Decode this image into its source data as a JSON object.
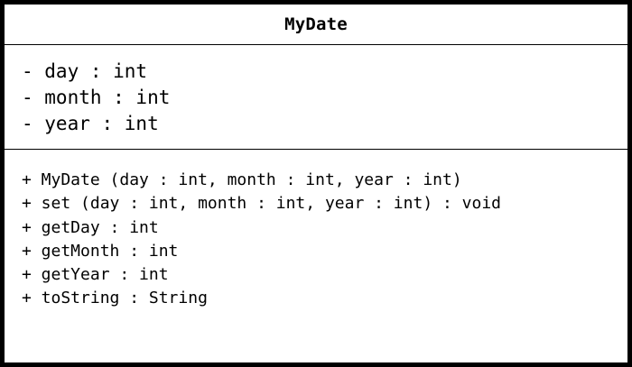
{
  "class": {
    "name": "MyDate",
    "attributes": [
      "- day : int",
      "- month : int",
      "- year : int"
    ],
    "operations": [
      "+ MyDate (day : int, month : int, year : int)",
      "+ set (day : int, month : int, year : int) : void",
      "+ getDay : int",
      "+ getMonth : int",
      "+ getYear : int",
      "+ toString : String"
    ]
  }
}
